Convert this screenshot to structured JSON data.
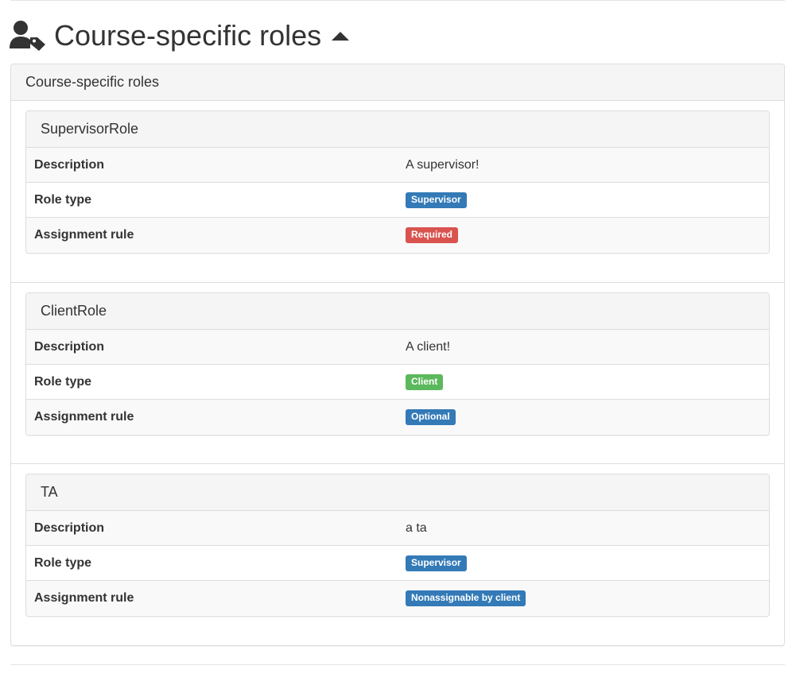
{
  "page": {
    "title": "Course-specific roles",
    "icon": "user-tag-icon",
    "toggle_icon": "caret-up-icon"
  },
  "panel": {
    "heading": "Course-specific roles"
  },
  "labels": {
    "description": "Description",
    "role_type": "Role type",
    "assignment_rule": "Assignment rule"
  },
  "colors": {
    "primary": "#337ab7",
    "danger": "#d9534f",
    "success": "#5cb85c"
  },
  "roles": [
    {
      "name": "SupervisorRole",
      "description": "A supervisor!",
      "role_type": "Supervisor",
      "role_type_style": "primary",
      "assignment_rule": "Required",
      "assignment_rule_style": "danger"
    },
    {
      "name": "ClientRole",
      "description": "A client!",
      "role_type": "Client",
      "role_type_style": "success",
      "assignment_rule": "Optional",
      "assignment_rule_style": "primary"
    },
    {
      "name": "TA",
      "description": "a ta",
      "role_type": "Supervisor",
      "role_type_style": "primary",
      "assignment_rule": "Nonassignable by client",
      "assignment_rule_style": "primary"
    }
  ]
}
